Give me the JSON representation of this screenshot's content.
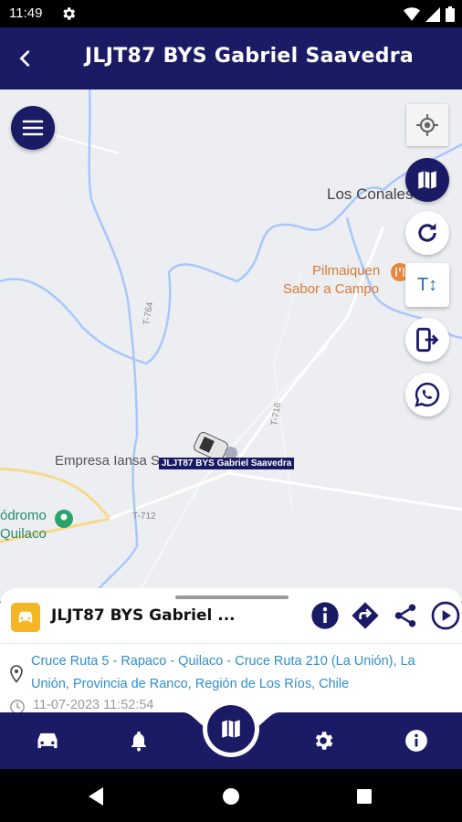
{
  "status_bar": {
    "time": "11:49",
    "icons": [
      "settings-icon",
      "wifi-icon",
      "signal-icon",
      "battery-icon"
    ]
  },
  "app_bar": {
    "title": "JLJT87 BYS Gabriel Saavedra",
    "back_icon": "chevron-left-icon"
  },
  "map": {
    "places": {
      "los_conales": "Los Conales",
      "pilmaiquen_line1": "Pilmaiquen",
      "pilmaiquen_line2": "Sabor a Campo",
      "empresa_iansa": "Empresa Iansa S",
      "dromo": "ódromo",
      "quilaco": "Quilaco"
    },
    "roads": [
      "T-764",
      "T-716",
      "T-712"
    ],
    "vehicle_label": "JLJT87 BYS Gabriel Saavedra",
    "controls": [
      "menu-icon",
      "my-location-icon",
      "map-layers-icon",
      "refresh-icon",
      "text-size-icon",
      "exit-icon",
      "whatsapp-icon"
    ],
    "text_size_glyph": "T↕",
    "colors": {
      "water": "#a8c7fa",
      "road": "#ffffff",
      "highway": "#f7d98a",
      "poi": "#d87a35"
    }
  },
  "vehicle_sheet": {
    "title": "JLJT87 BYS Gabriel ...",
    "vehicle_icon": "car-icon",
    "actions": [
      "info-icon",
      "directions-icon",
      "share-icon",
      "play-icon"
    ],
    "address": "Cruce Ruta 5 - Rapaco - Quilaco - Cruce Ruta 210 (La Unión), La Unión, Provincia de Ranco, Región de Los Ríos, Chile",
    "datetime": "11-07-2023 11:52:54"
  },
  "bottom_nav": {
    "items": [
      "car-icon",
      "bell-icon",
      "map-icon",
      "gear-icon",
      "info-icon"
    ],
    "active": "map-icon"
  },
  "theme": {
    "primary": "#1b1a64",
    "accent": "#f5b623",
    "link": "#2f8ecf"
  }
}
